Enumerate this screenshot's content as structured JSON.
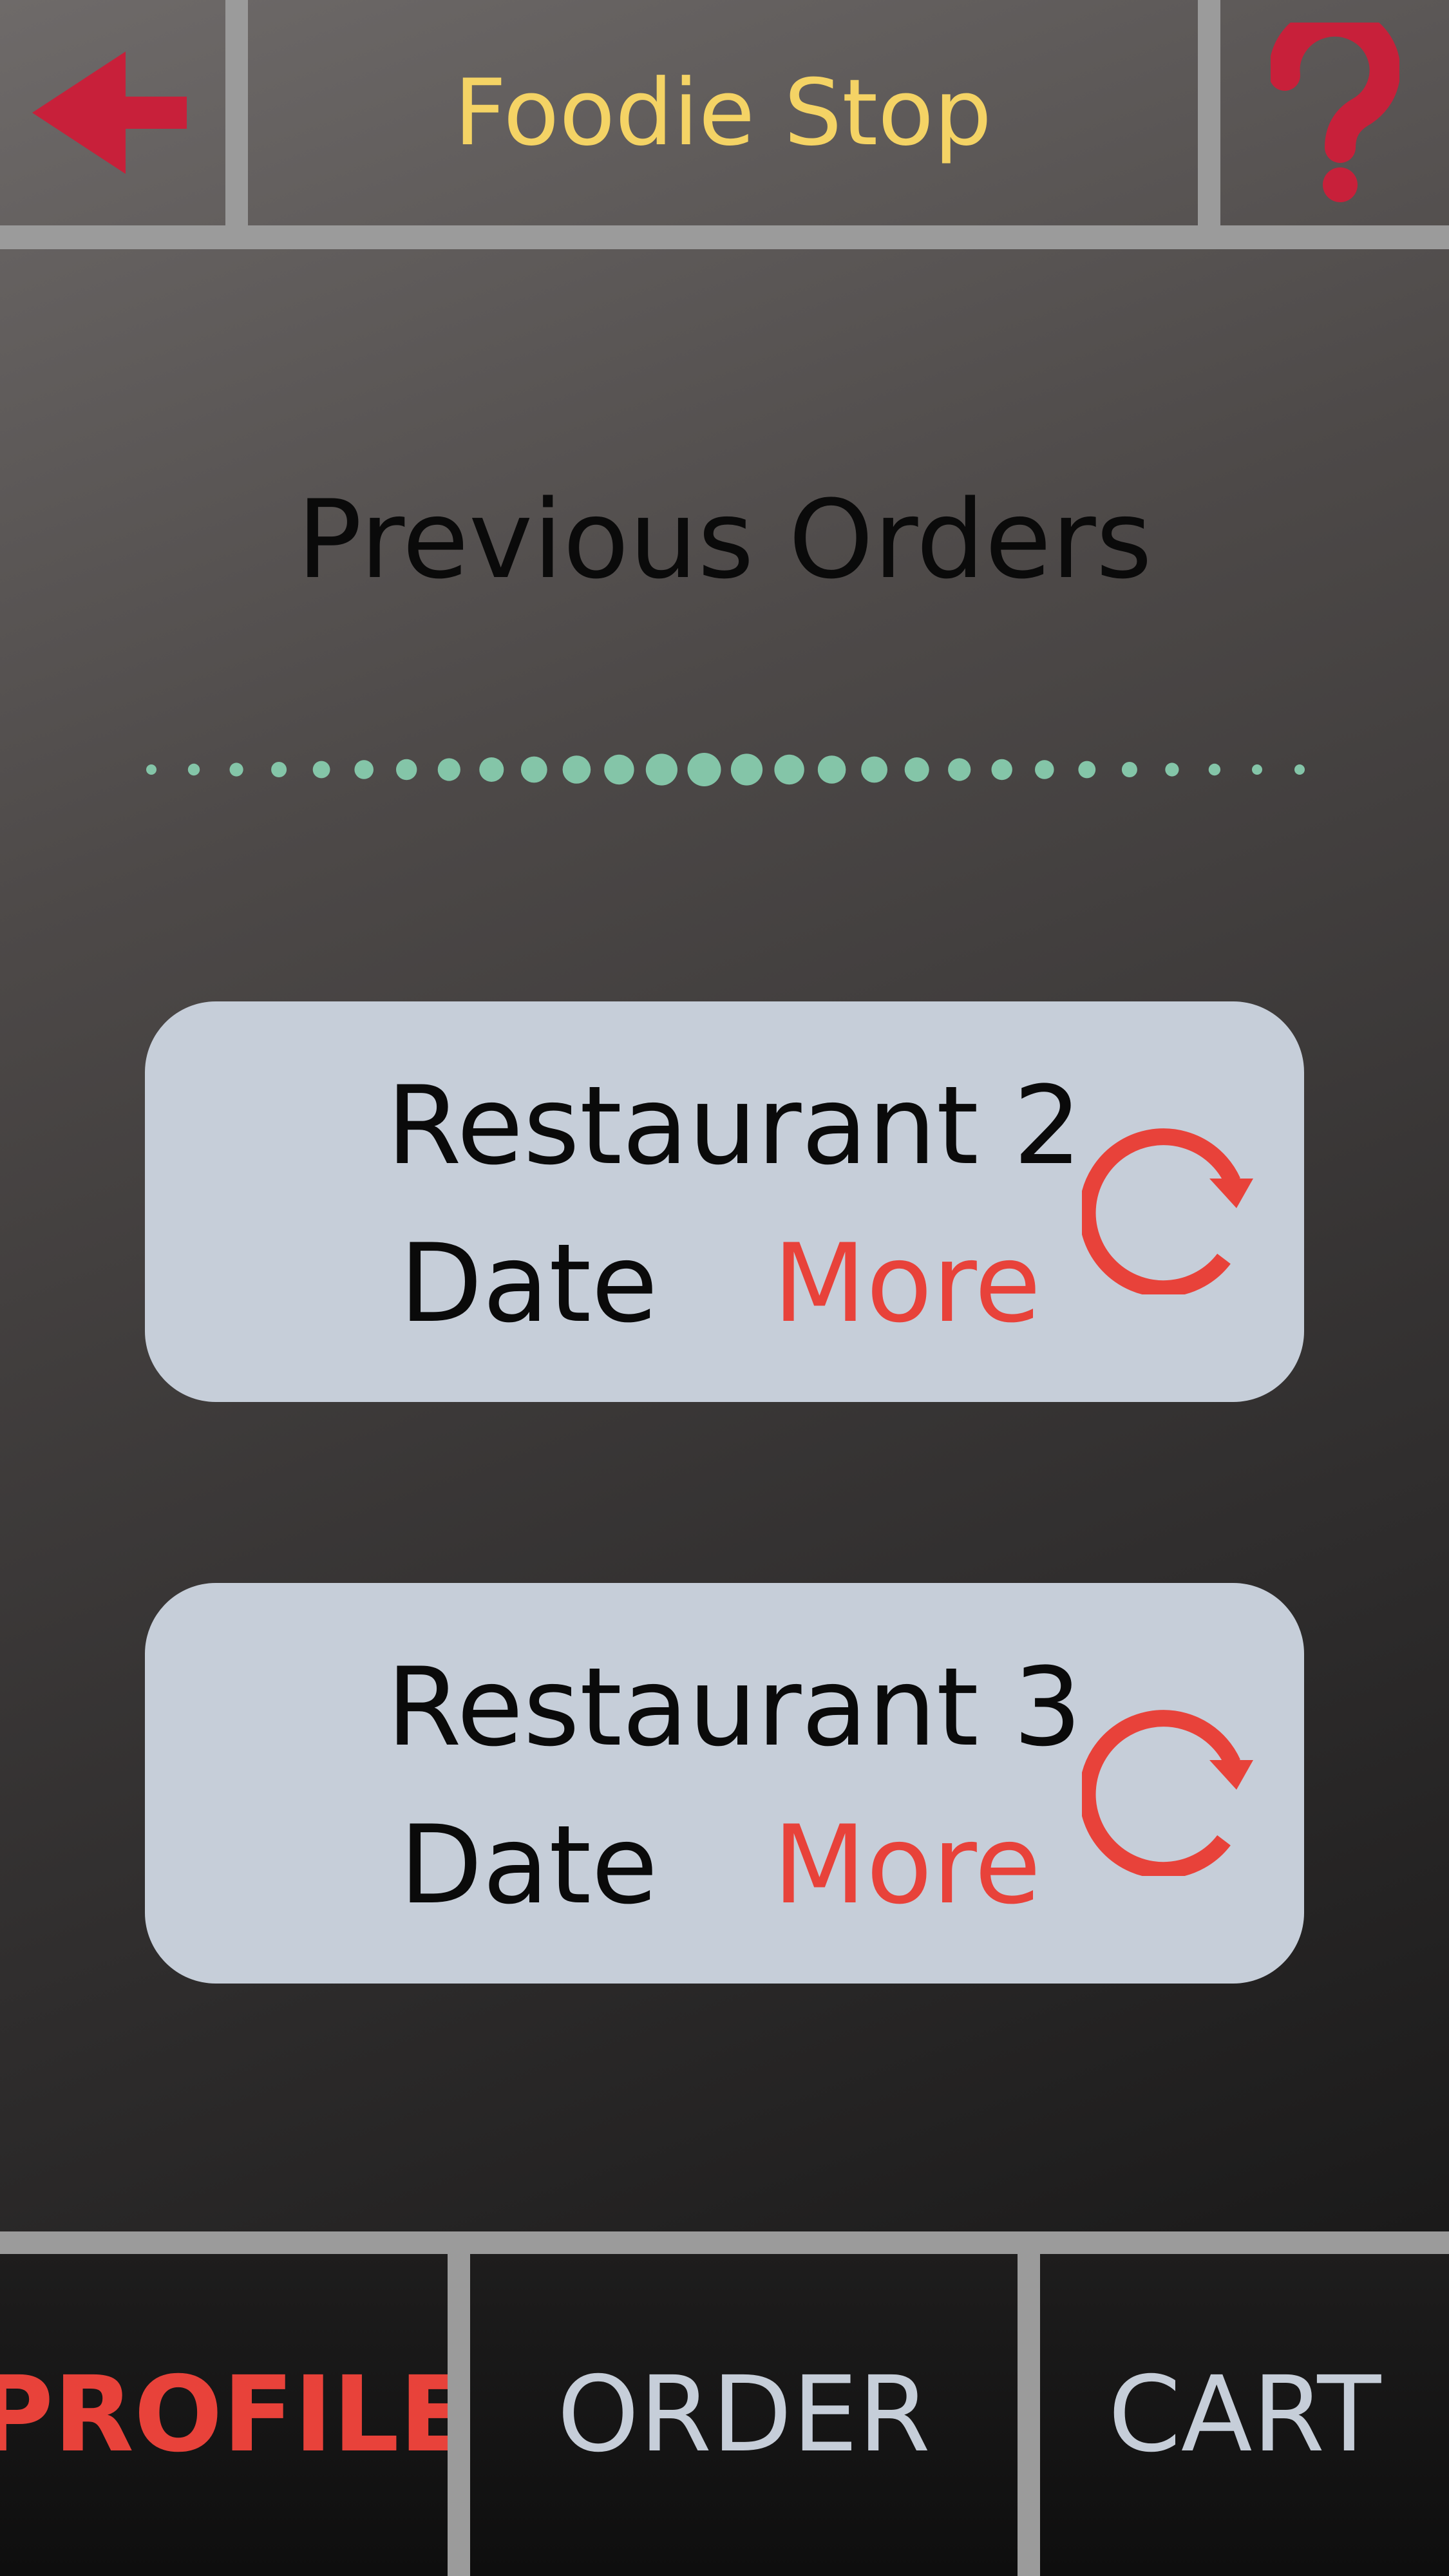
{
  "header": {
    "title": "Foodie Stop",
    "back_icon": "back-arrow-icon",
    "help_icon": "question-mark-icon",
    "title_color": "#f4d365",
    "icon_color": "#c8203a"
  },
  "main": {
    "title": "Previous Orders",
    "orders": [
      {
        "restaurant": "Restaurant 2",
        "date": "Date",
        "more": "More",
        "icon": "reorder-icon"
      },
      {
        "restaurant": "Restaurant 3",
        "date": "Date",
        "more": "More",
        "icon": "reorder-icon"
      }
    ]
  },
  "nav": {
    "tabs": [
      {
        "label": "PROFILE",
        "active": true
      },
      {
        "label": "ORDER",
        "active": false
      },
      {
        "label": "CART",
        "active": false
      }
    ],
    "active_color": "#e8423a",
    "inactive_color": "#c6ced9"
  },
  "colors": {
    "accent": "#e8423a",
    "card_bg": "#c6ced9",
    "divider_dots": "#84c5a8",
    "separator": "#9b9b9b"
  }
}
